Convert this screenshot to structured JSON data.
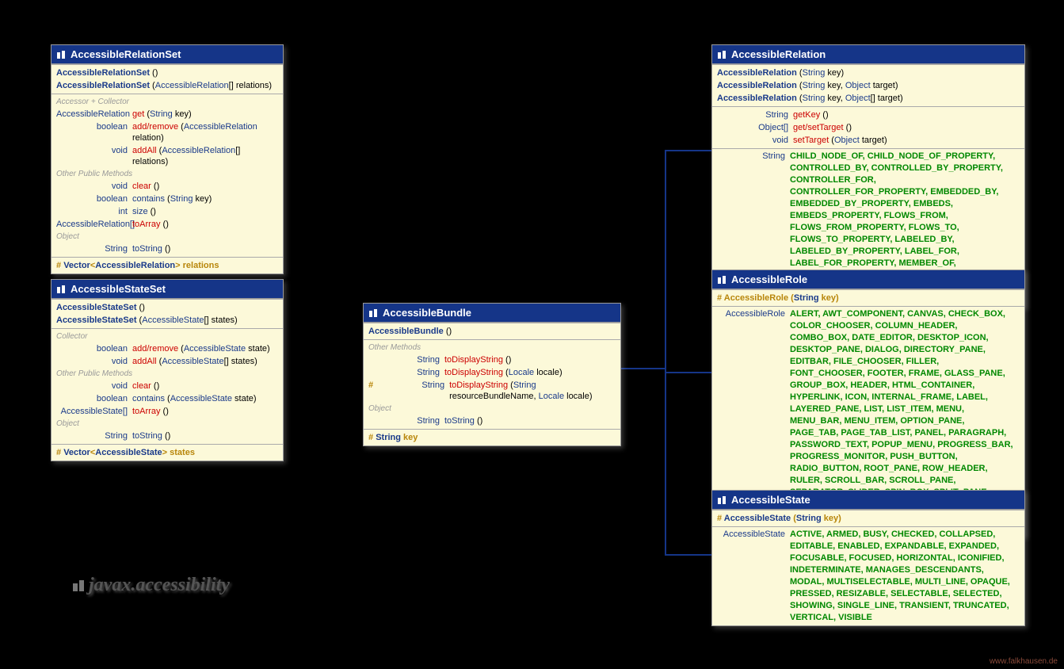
{
  "package": "javax.accessibility",
  "credit": "www.falkhausen.de",
  "classes": {
    "relSet": {
      "title": "AccessibleRelationSet",
      "ctors": [
        {
          "name": "AccessibleRelationSet",
          "args": "()"
        },
        {
          "name": "AccessibleRelationSet",
          "args": "(AccessibleRelation[] relations)"
        }
      ],
      "cat1": "Accessor + Collector",
      "acc": [
        {
          "ret": "AccessibleRelation",
          "name": "get",
          "args": "(String key)",
          "red": true
        },
        {
          "ret": "boolean",
          "name": "add/remove",
          "args": "(AccessibleRelation relation)",
          "red": true
        },
        {
          "ret": "void",
          "name": "addAll",
          "args": "(AccessibleRelation[] relations)",
          "red": true
        }
      ],
      "cat2": "Other Public Methods",
      "pub": [
        {
          "ret": "void",
          "name": "clear",
          "args": "()",
          "red": true
        },
        {
          "ret": "boolean",
          "name": "contains",
          "args": "(String key)"
        },
        {
          "ret": "int",
          "name": "size",
          "args": "()"
        },
        {
          "ret": "AccessibleRelation[]",
          "name": "toArray",
          "args": "()",
          "red": true
        }
      ],
      "cat3": "Object",
      "obj": [
        {
          "ret": "String",
          "name": "toString",
          "args": "()"
        }
      ],
      "field": "# Vector<AccessibleRelation> relations"
    },
    "stateSet": {
      "title": "AccessibleStateSet",
      "ctors": [
        {
          "name": "AccessibleStateSet",
          "args": "()"
        },
        {
          "name": "AccessibleStateSet",
          "args": "(AccessibleState[] states)"
        }
      ],
      "cat1": "Collector",
      "acc": [
        {
          "ret": "boolean",
          "name": "add/remove",
          "args": "(AccessibleState state)",
          "red": true
        },
        {
          "ret": "void",
          "name": "addAll",
          "args": "(AccessibleState[] states)",
          "red": true
        }
      ],
      "cat2": "Other Public Methods",
      "pub": [
        {
          "ret": "void",
          "name": "clear",
          "args": "()",
          "red": true
        },
        {
          "ret": "boolean",
          "name": "contains",
          "args": "(AccessibleState state)"
        },
        {
          "ret": "AccessibleState[]",
          "name": "toArray",
          "args": "()",
          "red": true
        }
      ],
      "cat3": "Object",
      "obj": [
        {
          "ret": "String",
          "name": "toString",
          "args": "()"
        }
      ],
      "field": "# Vector<AccessibleState> states"
    },
    "bundle": {
      "title": "AccessibleBundle",
      "ctors": [
        {
          "name": "AccessibleBundle",
          "args": "()"
        }
      ],
      "cat1": "Other Methods",
      "meth": [
        {
          "ret": "String",
          "name": "toDisplayString",
          "args": "()",
          "red": true
        },
        {
          "ret": "String",
          "name": "toDisplayString",
          "args": "(Locale locale)",
          "red": true
        },
        {
          "pre": "#",
          "ret": "String",
          "name": "toDisplayString",
          "args": "(String resourceBundleName, Locale locale)",
          "red": true
        }
      ],
      "cat2": "Object",
      "obj": [
        {
          "ret": "String",
          "name": "toString",
          "args": "()"
        }
      ],
      "field": "# String key"
    },
    "relation": {
      "title": "AccessibleRelation",
      "ctors": [
        {
          "name": "AccessibleRelation",
          "args": "(String key)"
        },
        {
          "name": "AccessibleRelation",
          "args": "(String key, Object target)"
        },
        {
          "name": "AccessibleRelation",
          "args": "(String key, Object[] target)"
        }
      ],
      "meth": [
        {
          "ret": "String",
          "name": "getKey",
          "args": "()",
          "red": true
        },
        {
          "ret": "Object[]",
          "name": "get/setTarget",
          "args": "()",
          "red": true
        },
        {
          "ret": "void",
          "name": "setTarget",
          "args": "(Object target)",
          "red": true
        }
      ],
      "constType": "String",
      "consts": "CHILD_NODE_OF, CHILD_NODE_OF_PROPERTY, CONTROLLED_BY, CONTROLLED_BY_PROPERTY, CONTROLLER_FOR, CONTROLLER_FOR_PROPERTY, EMBEDDED_BY, EMBEDDED_BY_PROPERTY, EMBEDS, EMBEDS_PROPERTY, FLOWS_FROM, FLOWS_FROM_PROPERTY, FLOWS_TO, FLOWS_TO_PROPERTY, LABELED_BY, LABELED_BY_PROPERTY, LABEL_FOR, LABEL_FOR_PROPERTY, MEMBER_OF, MEMBER_OF_PROPERTY, PARENT_WINDOW_OF, PARENT_WINDOW_OF_PROPERTY, SUBWINDOW_OF, SUBWINDOW_OF_PROPERTY"
    },
    "role": {
      "title": "AccessibleRole",
      "ctor": "# AccessibleRole (String key)",
      "constType": "AccessibleRole",
      "consts": "ALERT, AWT_COMPONENT, CANVAS, CHECK_BOX, COLOR_CHOOSER, COLUMN_HEADER, COMBO_BOX, DATE_EDITOR, DESKTOP_ICON, DESKTOP_PANE, DIALOG, DIRECTORY_PANE, EDITBAR, FILE_CHOOSER, FILLER, FONT_CHOOSER, FOOTER, FRAME, GLASS_PANE, GROUP_BOX, HEADER, HTML_CONTAINER, HYPERLINK, ICON, INTERNAL_FRAME, LABEL, LAYERED_PANE, LIST, LIST_ITEM, MENU, MENU_BAR, MENU_ITEM, OPTION_PANE, PAGE_TAB, PAGE_TAB_LIST, PANEL, PARAGRAPH, PASSWORD_TEXT, POPUP_MENU, PROGRESS_BAR, PROGRESS_MONITOR, PUSH_BUTTON, RADIO_BUTTON, ROOT_PANE, ROW_HEADER, RULER, SCROLL_BAR, SCROLL_PANE, SEPARATOR, SLIDER, SPIN_BOX, SPLIT_PANE, STATUS_BAR, SWING_COMPONENT, TABLE, TEXT, TOGGLE_BUTTON, TOOL_BAR, TOOL_TIP, TREE, UNKNOWN, VIEWPORT, WINDOW"
    },
    "state": {
      "title": "AccessibleState",
      "ctor": "# AccessibleState (String key)",
      "constType": "AccessibleState",
      "consts": "ACTIVE, ARMED, BUSY, CHECKED, COLLAPSED, EDITABLE, ENABLED, EXPANDABLE, EXPANDED, FOCUSABLE, FOCUSED, HORIZONTAL, ICONIFIED, INDETERMINATE, MANAGES_DESCENDANTS, MODAL, MULTISELECTABLE, MULTI_LINE, OPAQUE, PRESSED, RESIZABLE, SELECTABLE, SELECTED, SHOWING, SINGLE_LINE, TRANSIENT, TRUNCATED, VERTICAL, VISIBLE"
    }
  }
}
